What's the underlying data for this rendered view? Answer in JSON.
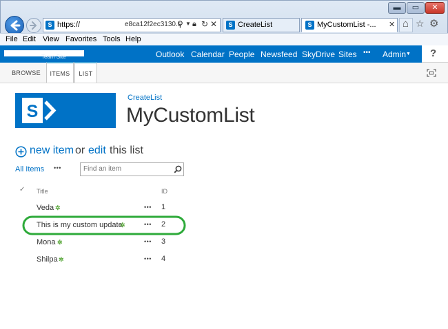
{
  "browser": {
    "address_url": "https://",
    "address_suffix": "e8ca12f2ec3130.s",
    "tabs": [
      {
        "label": "CreateList"
      },
      {
        "label": "MyCustomList -..."
      }
    ],
    "menu": [
      "File",
      "Edit",
      "View",
      "Favorites",
      "Tools",
      "Help"
    ]
  },
  "suite_bar": {
    "site_name": "Team Site",
    "links": [
      "Outlook",
      "Calendar",
      "People",
      "Newsfeed",
      "SkyDrive",
      "Sites"
    ],
    "more": "•••",
    "admin": "Admin",
    "help": "?"
  },
  "ribbon": {
    "tabs": [
      "BROWSE",
      "ITEMS",
      "LIST"
    ],
    "active": "ITEMS"
  },
  "page": {
    "breadcrumb": "CreateList",
    "title": "MyCustomList",
    "new_item": "new item",
    "or": "or",
    "edit": "edit",
    "this_list": "this list",
    "view": "All Items",
    "view_more": "•••",
    "search_placeholder": "Find an item"
  },
  "list": {
    "columns": {
      "title": "Title",
      "id": "ID"
    },
    "rows": [
      {
        "title": "Veda",
        "id": "1"
      },
      {
        "title": "This is my custom update",
        "id": "2"
      },
      {
        "title": "Mona",
        "id": "3"
      },
      {
        "title": "Shilpa",
        "id": "4"
      }
    ],
    "new_flag": "✲",
    "row_menu": "•••"
  },
  "colors": {
    "sharepoint_blue": "#0072c6",
    "link_blue": "#0072c6",
    "highlight_green": "#2eaa3a",
    "new_flag_green": "#5aa83c"
  }
}
